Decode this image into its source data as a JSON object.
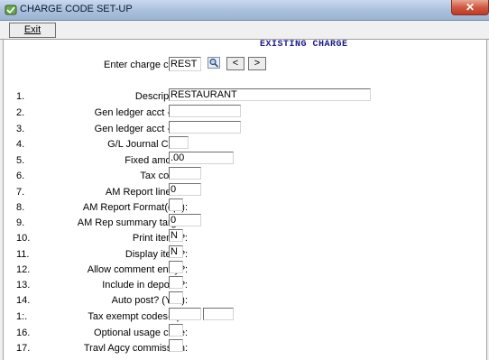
{
  "window": {
    "title": "CHARGE CODE SET-UP",
    "close_label": "✕"
  },
  "toolbar": {
    "exit_label": "Exit"
  },
  "header": {
    "mode": "EXISTING CHARGE"
  },
  "lookup": {
    "label": "Enter charge code:",
    "value": "REST",
    "prev_label": "<",
    "next_label": ">"
  },
  "form": {
    "fields": [
      {
        "num": "1.",
        "label": "Description:",
        "value": "RESTAURANT"
      },
      {
        "num": "2.",
        "label": "Gen ledger acct -DR:",
        "value": ""
      },
      {
        "num": "3.",
        "label": "Gen ledger acct -CR:",
        "value": ""
      },
      {
        "num": "4.",
        "label": "G/L Journal Code:",
        "value": ""
      },
      {
        "num": "5.",
        "label": "Fixed amount:",
        "value": ".00"
      },
      {
        "num": "6.",
        "label": "Tax codes:",
        "value": ""
      },
      {
        "num": "7.",
        "label": "AM Report line no:",
        "value": "0"
      },
      {
        "num": "8.",
        "label": "AM Report Format(opt):",
        "value": ""
      },
      {
        "num": "9.",
        "label": "AM Rep summary target:",
        "value": "0"
      },
      {
        "num": "10.",
        "label": "Print items?:",
        "value": "N"
      },
      {
        "num": "11.",
        "label": "Display item?:",
        "value": "N"
      },
      {
        "num": "12.",
        "label": "Allow comment entry?:",
        "value": ""
      },
      {
        "num": "13.",
        "label": "Include in deposit?:",
        "value": ""
      },
      {
        "num": "14.",
        "label": "Auto post? (Y/N):",
        "value": ""
      },
      {
        "num": "1:.",
        "label": "Tax exempt codes-opt:",
        "value": "",
        "value2": ""
      },
      {
        "num": "16.",
        "label": "Optional usage code:",
        "value": ""
      },
      {
        "num": "17.",
        "label": "Travl Agcy commission:",
        "value": ""
      }
    ]
  }
}
